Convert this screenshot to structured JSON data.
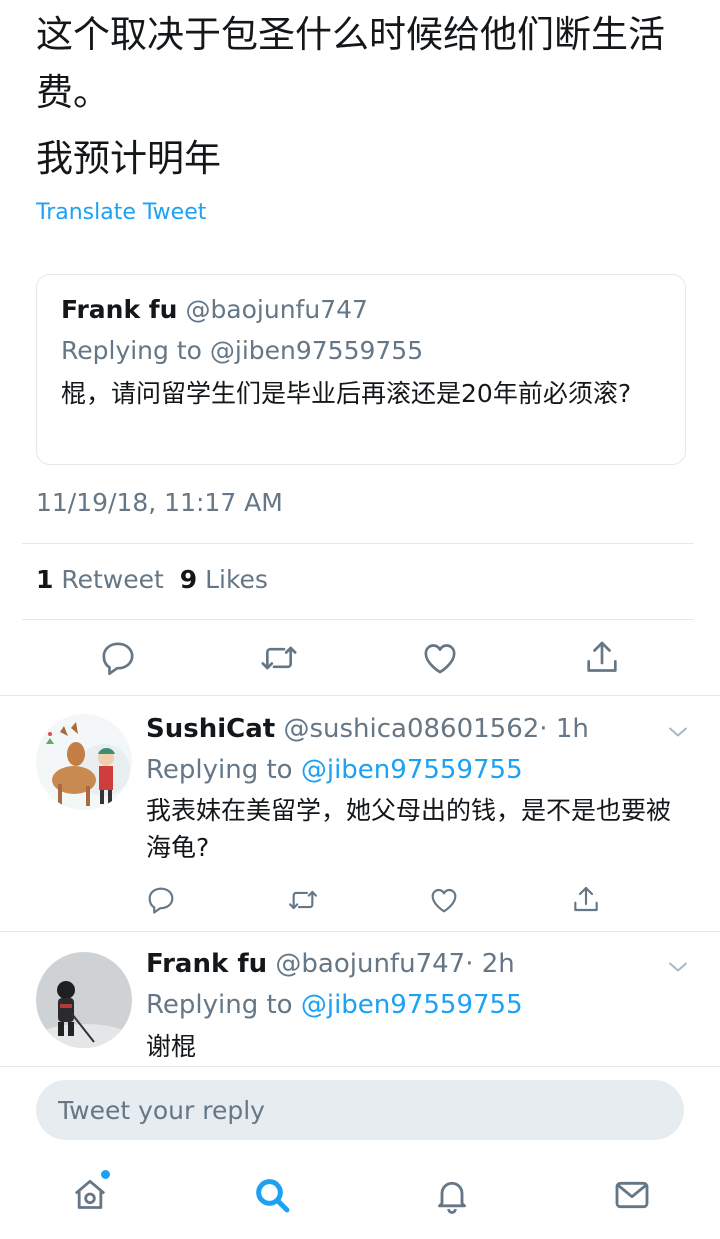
{
  "tweet": {
    "text_line1": "这个取决于包圣什么时候给他们断生活费。",
    "text_line2": "我预计明年",
    "translate_label": "Translate Tweet",
    "quoted": {
      "name": "Frank fu",
      "handle": "@baojunfu747",
      "replying_to": "Replying to @jiben97559755",
      "text": "棍，请问留学生们是毕业后再滚还是20年前必须滚?"
    },
    "timestamp": "11/19/18, 11:17 AM",
    "retweet_count": "1",
    "retweet_label": "Retweet",
    "like_count": "9",
    "like_label": "Likes"
  },
  "replies": [
    {
      "name": "SushiCat",
      "handle": "@sushica08601562",
      "time": "· 1h",
      "replying_prefix": "Replying to ",
      "replying_handle": "@jiben97559755",
      "text": "我表妹在美留学，她父母出的钱，是不是也要被海龟?"
    },
    {
      "name": "Frank fu",
      "handle": "@baojunfu747",
      "time": "· 2h",
      "replying_prefix": "Replying to ",
      "replying_handle": "@jiben97559755",
      "text": "谢棍"
    }
  ],
  "composer": {
    "placeholder": "Tweet your reply"
  },
  "colors": {
    "accent": "#1da1f2",
    "secondary_text": "#657786",
    "primary_text": "#14171a",
    "divider": "#e1e8ed"
  },
  "icons": [
    "reply-icon",
    "retweet-icon",
    "like-icon",
    "share-icon",
    "chevron-down-icon",
    "home-icon",
    "search-icon",
    "notifications-icon",
    "messages-icon"
  ]
}
